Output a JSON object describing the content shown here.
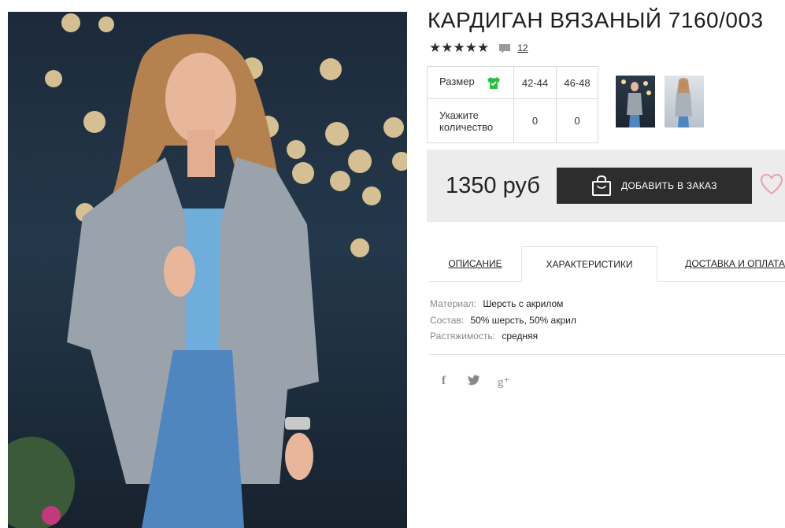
{
  "product": {
    "title": "КАРДИГАН ВЯЗАНЫЙ 7160/003",
    "stars": "★★★★★",
    "review_count": "12"
  },
  "size_table": {
    "size_label": "Размер",
    "qty_label_line1": "Укажите",
    "qty_label_line2": "количество",
    "sizes": [
      "42-44",
      "46-48"
    ],
    "quantities": [
      "0",
      "0"
    ]
  },
  "price_box": {
    "price": "1350 руб",
    "add_button_label": "ДОБАВИТЬ В ЗАКАЗ"
  },
  "tabs": {
    "description": "ОПИСАНИЕ",
    "characteristics": "ХАРАКТЕРИСТИКИ",
    "delivery": "ДОСТАВКА И ОПЛАТА"
  },
  "specs": [
    {
      "key": "Материал:",
      "value": "Шерсть с акрилом"
    },
    {
      "key": "Состав:",
      "value": "50% шерсть, 50% акрил"
    },
    {
      "key": "Растяжимость:",
      "value": "средняя"
    }
  ],
  "social": {
    "facebook": "f",
    "twitter": "🐦",
    "google_plus": "g⁺"
  },
  "colors": {
    "button_bg": "#2d2d2d",
    "price_bg": "#ececec",
    "shirt_icon": "#2bbf3f",
    "heart": "#e8a0b0"
  },
  "icons": [
    "comment-icon",
    "shirt-check-icon",
    "shopping-bag-icon",
    "heart-icon",
    "facebook-icon",
    "twitter-icon",
    "google-plus-icon"
  ]
}
